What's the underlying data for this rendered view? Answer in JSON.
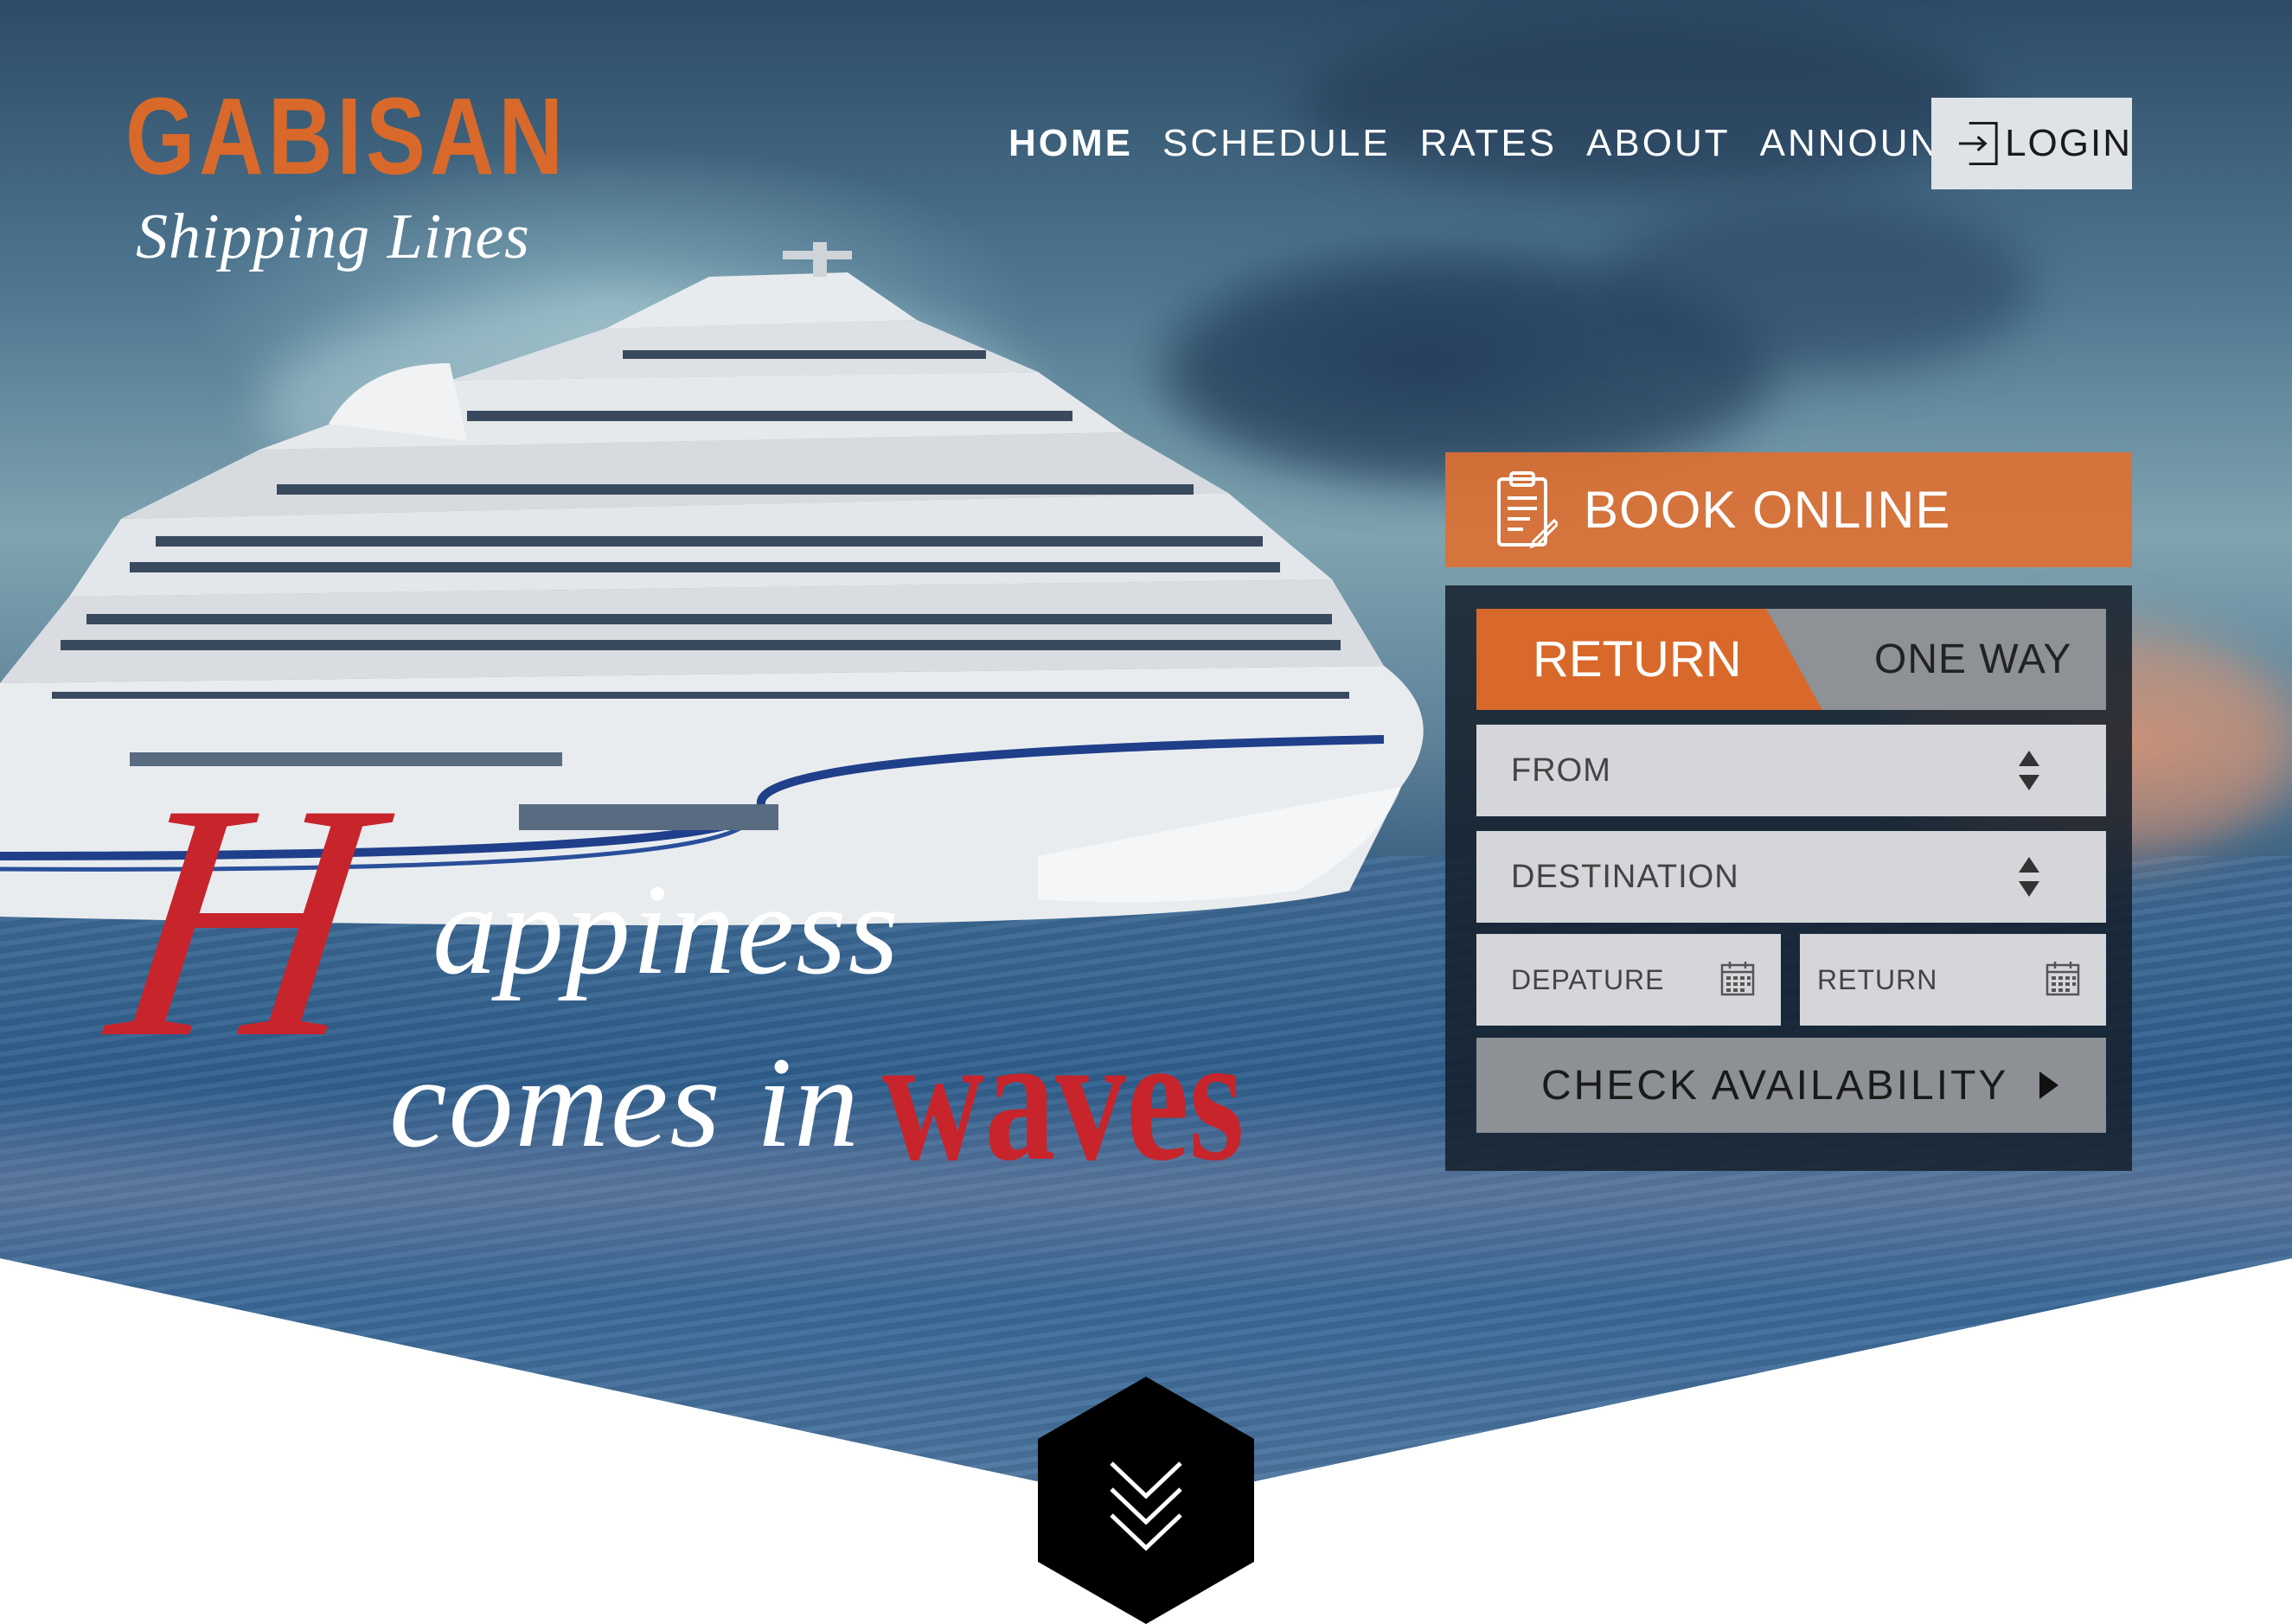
{
  "brand": {
    "name": "GABISAN",
    "tagline": "Shipping Lines",
    "accent_color": "#d8692a",
    "headline_red": "#c8242c"
  },
  "nav": {
    "items": [
      {
        "label": "HOME",
        "active": true
      },
      {
        "label": "SCHEDULE",
        "active": false
      },
      {
        "label": "RATES",
        "active": false
      },
      {
        "label": "ABOUT",
        "active": false
      },
      {
        "label": "ANNOUNCEMENT",
        "active": false
      }
    ],
    "login_label": "LOGIN",
    "login_icon": "login-icon"
  },
  "hero": {
    "cap_letter": "H",
    "line1_rest": "appiness",
    "line2": "comes in",
    "emphasis": "waves"
  },
  "booking": {
    "header": "BOOK ONLINE",
    "header_icon": "clipboard-icon",
    "tabs": {
      "return": "RETURN",
      "one_way": "ONE WAY",
      "selected": "RETURN"
    },
    "from_label": "FROM",
    "destination_label": "DESTINATION",
    "departure_label": "DEPATURE",
    "return_label": "RETURN",
    "check_label": "CHECK AVAILABILITY"
  },
  "scroll": {
    "icon": "double-chevron-down-icon"
  }
}
